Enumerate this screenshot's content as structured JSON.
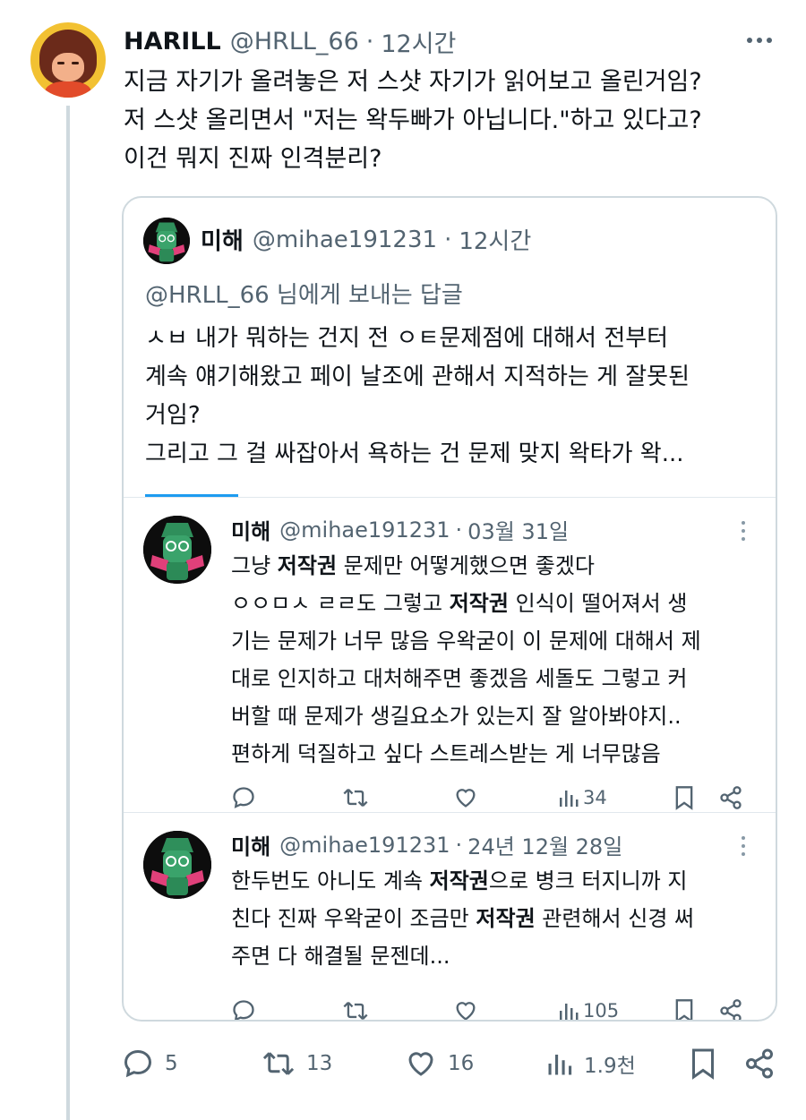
{
  "tweet": {
    "author_name": "HARILL",
    "author_handle": "@HRLL_66",
    "separator": "·",
    "time": "12시간",
    "lines": [
      "지금 자기가 올려놓은 저 스샷 자기가 읽어보고 올린거임?",
      "저 스샷 올리면서 \"저는 왁두빠가 아닙니다.\"하고 있다고?",
      "이건 뭐지 진짜 인격분리?"
    ],
    "stats": {
      "replies": "5",
      "retweets": "13",
      "likes": "16",
      "views": "1.9천"
    }
  },
  "quote": {
    "author_name": "미해",
    "author_handle": "@mihae191231",
    "separator": "·",
    "time": "12시간",
    "reply_to": "@HRLL_66 님에게 보내는 답글",
    "lines": [
      "ㅅㅂ 내가 뭐하는 건지 전 ㅇㅌ문제점에 대해서 전부터",
      "계속 얘기해왔고 페이 날조에 관해서 지적하는 게 잘못된",
      "거임?",
      "그리고 그 걸 싸잡아서 욕하는 건 문제 맞지 왁타가 왁..."
    ]
  },
  "search_results": [
    {
      "author_name": "미해",
      "author_handle": "@mihae191231",
      "separator": "·",
      "date": "03월 31일",
      "keyword": "저작권",
      "lines": [
        {
          "pre": "그냥 ",
          "bold": "저작권",
          "post": " 문제만 어떻게했으면 좋겠다"
        },
        {
          "pre": "ㅇㅇㅁㅅ ㄹㄹ도 그렇고 ",
          "bold": "저작권",
          "post": " 인식이 떨어져서 생"
        },
        {
          "pre": "기는 문제가 너무 많음 우왁굳이 이 문제에 대해서 제",
          "bold": "",
          "post": ""
        },
        {
          "pre": "대로 인지하고 대처해주면 좋겠음 세돌도 그렇고 커",
          "bold": "",
          "post": ""
        },
        {
          "pre": "버할 때 문제가 생길요소가 있는지 잘 알아봐야지..",
          "bold": "",
          "post": ""
        },
        {
          "pre": "편하게 덕질하고 싶다 스트레스받는 게 너무많음",
          "bold": "",
          "post": ""
        }
      ],
      "views": "34"
    },
    {
      "author_name": "미해",
      "author_handle": "@mihae191231",
      "separator": "·",
      "date": "24년 12월 28일",
      "keyword": "저작권",
      "lines": [
        {
          "pre": "한두번도 아니도 계속 ",
          "bold": "저작권",
          "post": "으로 병크 터지니까 지"
        },
        {
          "pre": "친다 진짜 우왁굳이 조금만 ",
          "bold": "저작권",
          "post": " 관련해서 신경 써"
        },
        {
          "pre": "주면 다 해결될 문젠데...",
          "bold": "",
          "post": ""
        }
      ],
      "views": "105"
    }
  ],
  "icons": {
    "more": "more-horizontal-icon",
    "reply": "reply-icon",
    "retweet": "retweet-icon",
    "like": "heart-icon",
    "views": "views-chart-icon",
    "bookmark": "bookmark-icon",
    "share": "share-icon"
  },
  "colors": {
    "text": "#0f1419",
    "secondary": "#536471",
    "border": "#cfd9de",
    "accent": "#1d9bf0"
  }
}
